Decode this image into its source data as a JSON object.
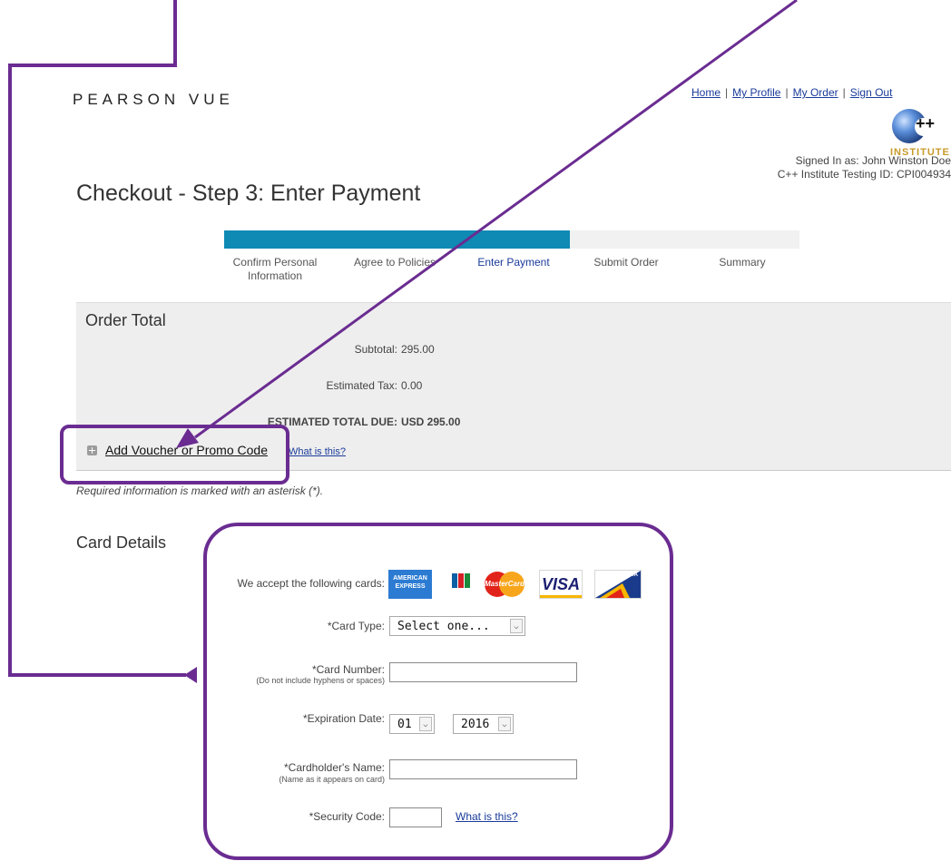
{
  "brand": {
    "logo_text": "PEARSON VUE"
  },
  "header": {
    "nav_links": [
      "Home",
      "My Profile",
      "My Order",
      "Sign Out"
    ],
    "signed_in_text": "Signed In as: John Winston Doe",
    "testing_id_text": "C++ Institute Testing ID: CPI004934",
    "institute_logo_text": "INSTITUTE",
    "institute_logo_plus": "++"
  },
  "page_title": "Checkout - Step 3: Enter Payment",
  "progress": {
    "completed_fraction": 0.6,
    "steps": [
      {
        "label": "Confirm Personal",
        "label2": "Information"
      },
      {
        "label": "Agree to Policies"
      },
      {
        "label": "Enter Payment",
        "active": true
      },
      {
        "label": "Submit Order"
      },
      {
        "label": "Summary"
      }
    ]
  },
  "order_total": {
    "title": "Order Total",
    "subtotal_label": "Subtotal:",
    "subtotal_value": "295.00",
    "tax_label": "Estimated Tax:",
    "tax_value": "0.00",
    "total_label": "ESTIMATED TOTAL DUE:",
    "total_value": "USD 295.00"
  },
  "voucher": {
    "link_text": "Add Voucher or Promo Code",
    "whatis_text": "What is this?"
  },
  "required_note": "Required information is marked with an asterisk (*).",
  "card_details": {
    "title": "Card Details",
    "accept_label": "We accept the following cards:",
    "card_logos": {
      "amex_line1": "AMERICAN",
      "amex_line2": "EXPRESS",
      "mastercard": "MasterCard",
      "visa": "VISA",
      "delta": "DELTA"
    },
    "card_type_label": "*Card Type:",
    "card_type_value": "Select one...",
    "card_number_label": "*Card Number:",
    "card_number_hint": "(Do not include hyphens or spaces)",
    "expiration_label": "*Expiration Date:",
    "exp_month_value": "01",
    "exp_year_value": "2016",
    "cardholder_label": "*Cardholder's Name:",
    "cardholder_hint": "(Name as it appears on card)",
    "security_label": "*Security Code:",
    "security_whatis": "What is this?"
  },
  "colors": {
    "progress_fill": "#0e8ab4",
    "annotation": "#6a2c91",
    "link": "#1a3b9a"
  }
}
